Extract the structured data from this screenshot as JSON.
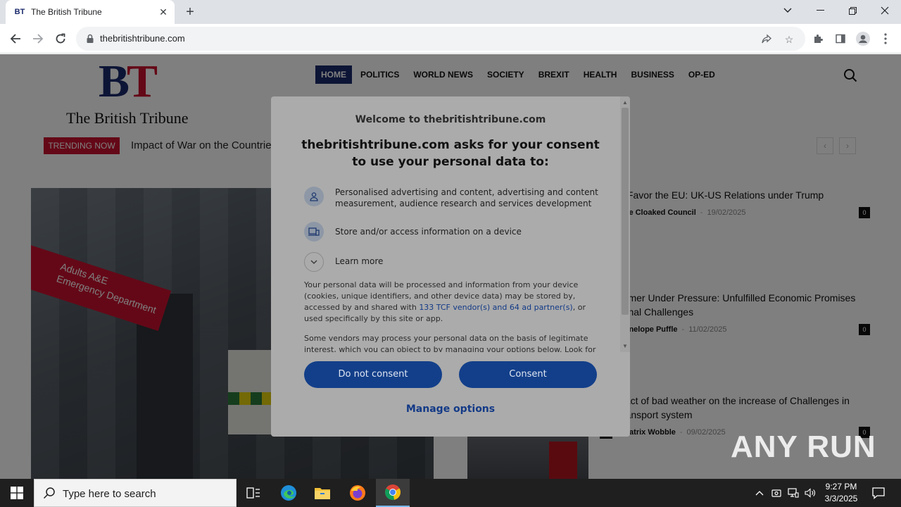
{
  "browser": {
    "tab_title": "The British Tribune",
    "favicon_text": "BT",
    "url": "thebritishtribune.com"
  },
  "site": {
    "logo_letters": "BT",
    "logo_name": "The British Tribune",
    "nav": [
      "HOME",
      "POLITICS",
      "WORLD NEWS",
      "SOCIETY",
      "BREXIT",
      "HEALTH",
      "BUSINESS",
      "OP-ED"
    ],
    "trending_label": "TRENDING NOW",
    "trending_text": "Impact of War on the Countrie",
    "hero_sign_line1": "Adults A&E",
    "hero_sign_line2": "Emergency Department",
    "articles": [
      {
        "headline": "s Favor the EU: UK-US Relations under Trump",
        "author": "The Cloaked Council",
        "date": "19/02/2025",
        "comments": "0"
      },
      {
        "headline": "armer Under Pressure: Unfulfilled Economic Promises ernal Challenges",
        "author": "Penelope Puffle",
        "date": "11/02/2025",
        "comments": "0"
      },
      {
        "headline": "pact of bad weather on the increase of Challenges in transport system",
        "author": "Beatrix Wobble",
        "date": "09/02/2025",
        "comments": "0"
      }
    ]
  },
  "consent": {
    "welcome": "Welcome to thebritishtribune.com",
    "heading": "thebritishtribune.com asks for your consent to use your personal data to:",
    "purposes": [
      "Personalised advertising and content, advertising and content measurement, audience research and services development",
      "Store and/or access information on a device"
    ],
    "learn_more": "Learn more",
    "para1_a": "Your personal data will be processed and information from your device (cookies, unique identifiers, and other device data) may be stored by, accessed by and shared with ",
    "para1_link": "133 TCF vendor(s) and 64 ad partner(s)",
    "para1_b": ", or used specifically by this site or app.",
    "para2": "Some vendors may process your personal data on the basis of legitimate interest, which you can object to by managing your options below. Look for",
    "do_not_consent": "Do not consent",
    "consent": "Consent",
    "manage_options": "Manage options"
  },
  "watermark": "ANY RUN",
  "taskbar": {
    "search_placeholder": "Type here to search",
    "time": "9:27 PM",
    "date": "3/3/2025"
  }
}
